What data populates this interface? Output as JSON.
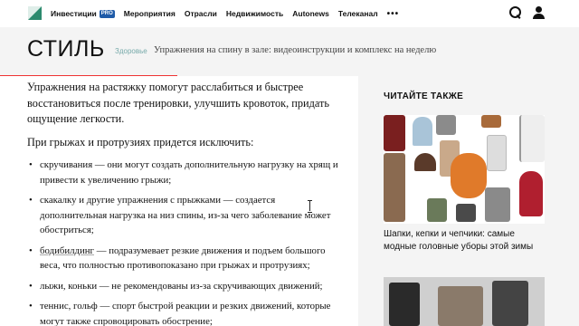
{
  "nav": {
    "items": [
      {
        "label": "Инвестиции",
        "badge": "PRO"
      },
      {
        "label": "Мероприятия"
      },
      {
        "label": "Отрасли"
      },
      {
        "label": "Недвижимость"
      },
      {
        "label": "Autonews"
      },
      {
        "label": "Телеканал"
      }
    ],
    "more": "•••",
    "icons": [
      "search-icon",
      "user-icon"
    ]
  },
  "header": {
    "section": "СТИЛЬ",
    "category": "Здоровье",
    "title": "Упражнения на спину в зале: видеоинструкции и комплекс на неделю"
  },
  "article": {
    "para1": "Упражнения на растяжку помогут расслабиться и быстрее восстановиться после тренировки, улучшить кровоток, придать ощущение легкости.",
    "para2": "При грыжах и протрузиях придется исключить:",
    "bullets": [
      {
        "text": "скручивания — они могут создать дополнительную нагрузку на хрящ и привести к увеличению грыжи;"
      },
      {
        "text": "скакалку и другие упражнения с прыжками — создается дополнительная нагрузка на низ спины, из-за чего заболевание может обостриться;"
      },
      {
        "term": "бодибилдинг",
        "text": " — подразумевает резкие движения и подъем большого веса, что полностью противопоказано при грыжах и протрузиях;"
      },
      {
        "text": "лыжи, коньки — не рекомендованы из-за скручивающих движений;"
      },
      {
        "text": "теннис, гольф — спорт быстрой реакции и резких движений, которые могут также спровоцировать обострение;"
      }
    ]
  },
  "sidebar": {
    "heading": "ЧИТАЙТЕ ТАКЖЕ",
    "card1_title": "Шапки, кепки и чепчики: самые модные головные уборы этой зимы"
  },
  "colors": {
    "accent": "#e33333",
    "logo": "#2c8a6e",
    "badge": "#1f5ba8",
    "header_bg": "#f4f4f4"
  }
}
